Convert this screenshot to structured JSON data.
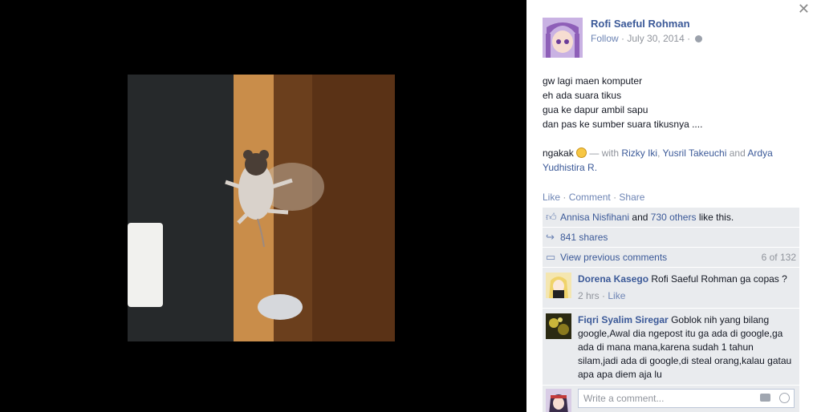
{
  "post": {
    "author": "Rofi Saeful Rohman",
    "follow": "Follow",
    "date": "July 30, 2014",
    "lines": [
      "gw lagi maen komputer",
      "eh ada suara tikus",
      "gua ke dapur ambil sapu",
      "dan pas ke sumber suara tikusnya ...."
    ],
    "tail": "ngakak",
    "with_prefix": "— with",
    "tag1": "Rizky Iki",
    "tag2": "Yusril Takeuchi",
    "and": "and",
    "tag3": "Ardya Yudhistira R."
  },
  "actions": {
    "like": "Like",
    "comment": "Comment",
    "share": "Share"
  },
  "likes": {
    "name": "Annisa Nisfihani",
    "and": "and",
    "others": "730 others",
    "suffix": "like this."
  },
  "shares": "841 shares",
  "view_previous": {
    "label": "View previous comments",
    "count": "6 of 132"
  },
  "comments": [
    {
      "name": "Dorena Kasego",
      "text": "Rofi Saeful Rohman ga copas ?",
      "time": "2 hrs",
      "like": "Like"
    },
    {
      "name": "Fiqri Syalim Siregar",
      "text": "Goblok nih yang bilang google,Awal dia ngepost itu ga ada di google,ga ada di mana mana,karena sudah 1 tahun silam,jadi ada di google,di steal orang,kalau gatau apa apa diem aja lu"
    }
  ],
  "write_placeholder": "Write a comment...",
  "icons": {
    "close": "close-icon",
    "globe": "globe-icon",
    "thumb": "thumbs-up-icon",
    "share": "share-icon",
    "comment": "comment-icon",
    "camera": "camera-icon",
    "smiley": "smiley-icon",
    "emoji": "laughing-emoji-icon"
  },
  "colors": {
    "link": "#3b5998",
    "muted": "#90949c",
    "ufi_bg": "#e9ebee"
  }
}
